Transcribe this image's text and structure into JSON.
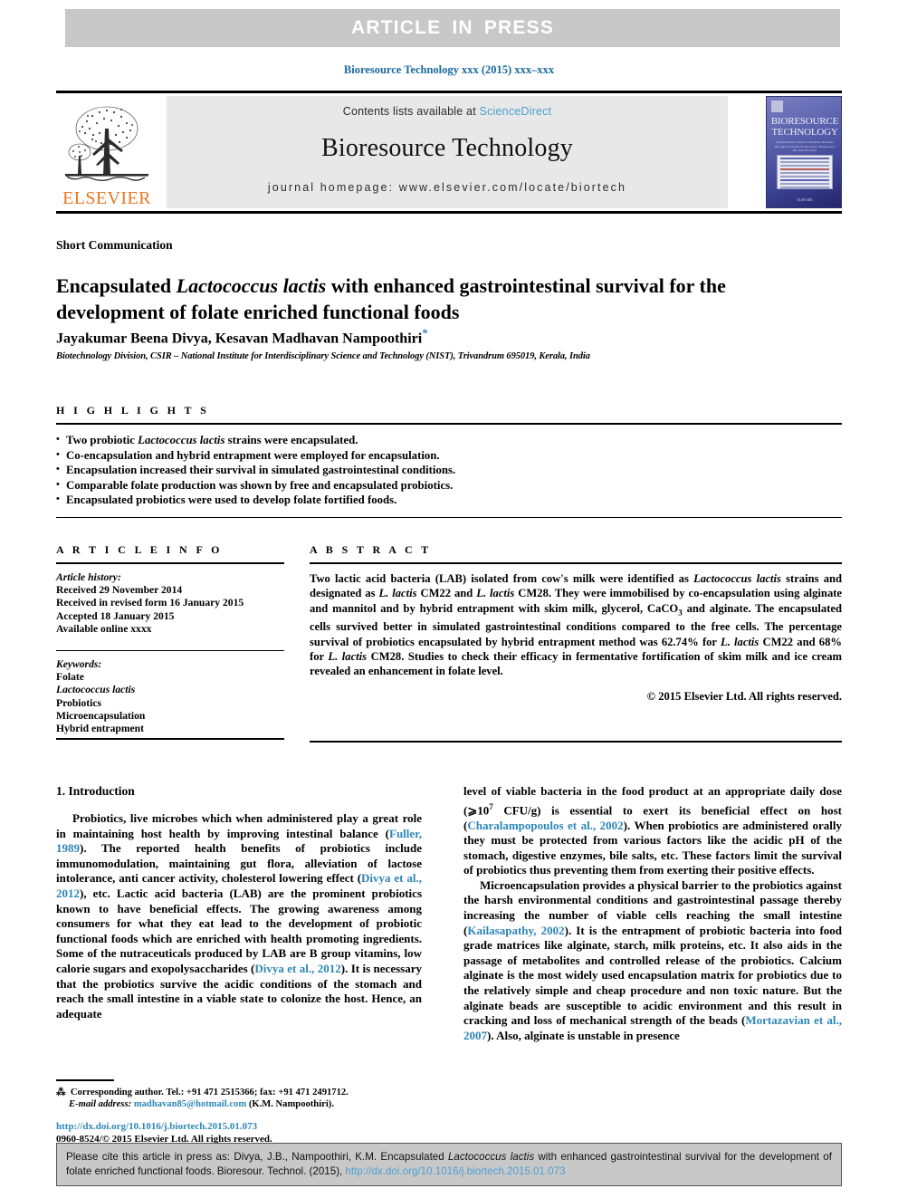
{
  "banner": {
    "text": "ARTICLE  IN  PRESS"
  },
  "journal_ref": "Bioresource Technology xxx (2015) xxx–xxx",
  "masthead": {
    "contents_prefix": "Contents lists available at ",
    "sciencedirect": "ScienceDirect",
    "journal_title": "Bioresource Technology",
    "homepage": "journal homepage: www.elsevier.com/locate/biortech",
    "publisher_wordmark": "ELSEVIER",
    "cover": {
      "title": "BIORESOURCE TECHNOLOGY",
      "subtitle": "An International Journal on Biomass, Biowaste, Biological Residues for Bioenergy, Biofuels and Bio-based Products",
      "footer": "ELSEVIER"
    }
  },
  "article": {
    "type_label": "Short Communication",
    "title_part1": "Encapsulated ",
    "title_species": "Lactococcus lactis",
    "title_part2": " with enhanced gastrointestinal survival for the development of folate enriched functional foods",
    "authors": "Jayakumar Beena Divya, Kesavan Madhavan Nampoothiri",
    "corresponding_marker": "*",
    "affiliation": "Biotechnology Division, CSIR – National Institute for Interdisciplinary Science and Technology (NIST), Trivandrum 695019, Kerala, India"
  },
  "highlights": {
    "heading": "H I G H L I G H T S",
    "items": [
      "Two probiotic Lactococcus lactis strains were encapsulated.",
      "Co-encapsulation and hybrid entrapment were employed for encapsulation.",
      "Encapsulation increased their survival in simulated gastrointestinal conditions.",
      "Comparable folate production was shown by free and encapsulated probiotics.",
      "Encapsulated probiotics were used to develop folate fortified foods."
    ]
  },
  "article_info": {
    "heading": "A R T I C L E   I N F O",
    "history_label": "Article history:",
    "history": [
      "Received 29 November 2014",
      "Received in revised form 16 January 2015",
      "Accepted 18 January 2015",
      "Available online xxxx"
    ],
    "keywords_label": "Keywords:",
    "keywords": [
      "Folate",
      "Lactococcus lactis",
      "Probiotics",
      "Microencapsulation",
      "Hybrid entrapment"
    ]
  },
  "abstract": {
    "heading": "A B S T R A C T",
    "text": "Two lactic acid bacteria (LAB) isolated from cow's milk were identified as Lactococcus lactis strains and designated as L. lactis CM22 and L. lactis CM28. They were immobilised by co-encapsulation using alginate and mannitol and by hybrid entrapment with skim milk, glycerol, CaCO3 and alginate. The encapsulated cells survived better in simulated gastrointestinal conditions compared to the free cells. The percentage survival of probiotics encapsulated by hybrid entrapment method was 62.74% for L. lactis CM22 and 68% for L. lactis CM28. Studies to check their efficacy in fermentative fortification of skim milk and ice cream revealed an enhancement in folate level.",
    "copyright": "© 2015 Elsevier Ltd. All rights reserved."
  },
  "body": {
    "section_title": "1. Introduction",
    "left_p1": "Probiotics, live microbes which when administered play a great role in maintaining host health by improving intestinal balance (Fuller, 1989). The reported health benefits of probiotics include immunomodulation, maintaining gut flora, alleviation of lactose intolerance, anti cancer activity, cholesterol lowering effect (Divya et al., 2012), etc. Lactic acid bacteria (LAB) are the prominent probiotics known to have beneficial effects. The growing awareness among consumers for what they eat lead to the development of probiotic functional foods which are enriched with health promoting ingredients. Some of the nutraceuticals produced by LAB are B group vitamins, low calorie sugars and exopolysaccharides (Divya et al., 2012). It is necessary that the probiotics survive the acidic conditions of the stomach and reach the small intestine in a viable state to colonize the host. Hence, an adequate",
    "right_p1": "level of viable bacteria in the food product at an appropriate daily dose (⩾10⁷ CFU/g) is essential to exert its beneficial effect on host (Charalampopoulos et al., 2002). When probiotics are administered orally they must be protected from various factors like the acidic pH of the stomach, digestive enzymes, bile salts, etc. These factors limit the survival of probiotics thus preventing them from exerting their positive effects.",
    "right_p2": "Microencapsulation provides a physical barrier to the probiotics against the harsh environmental conditions and gastrointestinal passage thereby increasing the number of viable cells reaching the small intestine (Kailasapathy, 2002). It is the entrapment of probiotic bacteria into food grade matrices like alginate, starch, milk proteins, etc. It also aids in the passage of metabolites and controlled release of the probiotics. Calcium alginate is the most widely used encapsulation matrix for probiotics due to the relatively simple and cheap procedure and non toxic nature. But the alginate beads are susceptible to acidic environment and this result in cracking and loss of mechanical strength of the beads (Mortazavian et al., 2007). Also, alginate is unstable in presence",
    "references_inline": [
      "Fuller, 1989",
      "Divya et al., 2012",
      "Charalampopoulos et al., 2002",
      "Kailasapathy, 2002",
      "Mortazavian et al., 2007"
    ]
  },
  "footnote": {
    "corresponding": "Corresponding author. Tel.: +91 471 2515366; fax: +91 471 2491712.",
    "email_label": "E-mail address:",
    "email": "madhavan85@hotmail.com",
    "email_owner": "(K.M. Nampoothiri)."
  },
  "doi_block": {
    "doi_url": "http://dx.doi.org/10.1016/j.biortech.2015.01.073",
    "issn_line": "0960-8524/© 2015 Elsevier Ltd. All rights reserved."
  },
  "cite_box": {
    "prefix": "Please cite this article in press as: Divya, J.B., Nampoothiri, K.M. Encapsulated ",
    "species": "Lactococcus lactis",
    "middle": " with enhanced gastrointestinal survival for the development of folate enriched functional foods. Bioresour. Technol. (2015), ",
    "doi": "http://dx.doi.org/10.1016/j.biortech.2015.01.073"
  },
  "colors": {
    "banner_bg": "#c8c8c8",
    "masthead_band": "#e8e8e8",
    "link_blue": "#2e86b7",
    "sciencedirect_blue": "#4d9fd3",
    "journal_ref_blue": "#17699e",
    "elsevier_orange": "#e87722"
  }
}
